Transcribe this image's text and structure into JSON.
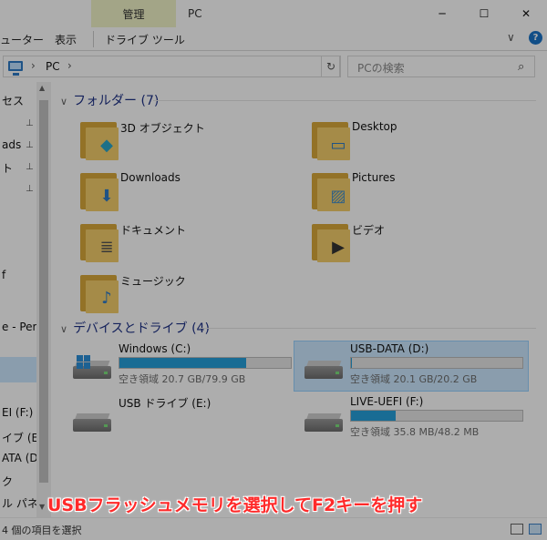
{
  "titlebar": {
    "manage_tab": "管理",
    "title": "PC",
    "minimize": "─",
    "maximize": "☐",
    "close": "✕"
  },
  "ribbon": {
    "tabs": [
      "ューター",
      "表示",
      "ドライブ ツール"
    ],
    "expand": "∨",
    "help": "?"
  },
  "address": {
    "path": "PC",
    "sep": "›",
    "refresh": "↻",
    "search_placeholder": "PCの検索",
    "search_icon": "⌕"
  },
  "nav": {
    "items": [
      {
        "label": "セス",
        "pinned": false
      },
      {
        "label": "ads",
        "pinned": true
      },
      {
        "label": "ト",
        "pinned": true
      },
      {
        "label": "",
        "pinned": true
      },
      {
        "label": "",
        "pinned": true
      },
      {
        "label": "f",
        "pinned": false
      },
      {
        "label": "e - Perso",
        "pinned": false
      },
      {
        "label": "EI (F:)",
        "pinned": false
      },
      {
        "label": "イブ (E:)",
        "pinned": false
      },
      {
        "label": "ATA (D:)",
        "pinned": false
      },
      {
        "label": "ク",
        "pinned": false
      },
      {
        "label": "ル パネル",
        "pinned": false
      }
    ],
    "pin_glyph": "📌"
  },
  "groups": {
    "folders": {
      "title": "フォルダー (7)",
      "chevron": "∨"
    },
    "drives": {
      "title": "デバイスとドライブ (4)",
      "chevron": "∨"
    }
  },
  "folders": [
    {
      "label": "3D オブジェクト",
      "icon": "cube-icon",
      "emblem": "◆",
      "emblem_color": "#2aa6c9"
    },
    {
      "label": "Desktop",
      "icon": "desktop-icon",
      "emblem": "▭",
      "emblem_color": "#2e7bc6"
    },
    {
      "label": "Downloads",
      "icon": "download-icon",
      "emblem": "⬇",
      "emblem_color": "#2e7bc6"
    },
    {
      "label": "Pictures",
      "icon": "picture-icon",
      "emblem": "▨",
      "emblem_color": "#4a8fc4"
    },
    {
      "label": "ドキュメント",
      "icon": "document-icon",
      "emblem": "≣",
      "emblem_color": "#555555"
    },
    {
      "label": "ビデオ",
      "icon": "video-icon",
      "emblem": "▶",
      "emblem_color": "#333333"
    },
    {
      "label": "ミュージック",
      "icon": "music-icon",
      "emblem": "♪",
      "emblem_color": "#2e7bc6"
    }
  ],
  "drives": [
    {
      "label": "Windows (C:)",
      "free": "空き領域 20.7 GB/79.9 GB",
      "used_fraction": 0.74,
      "system": true
    },
    {
      "label": "USB-DATA (D:)",
      "free": "空き領域 20.1 GB/20.2 GB",
      "used_fraction": 0.005,
      "selected": true
    },
    {
      "label": "USB ドライブ (E:)",
      "free": "",
      "used_fraction": null
    },
    {
      "label": "LIVE-UEFI (F:)",
      "free": "空き領域 35.8 MB/48.2 MB",
      "used_fraction": 0.26
    }
  ],
  "status": {
    "text": "4 個の項目を選択"
  },
  "caption": "USBフラッシュメモリを選択してF2キーを押す",
  "colors": {
    "accent": "#26a0da",
    "selection": "#cce8ff",
    "caption": "#ff2a2a",
    "group_header": "#1e3287"
  }
}
